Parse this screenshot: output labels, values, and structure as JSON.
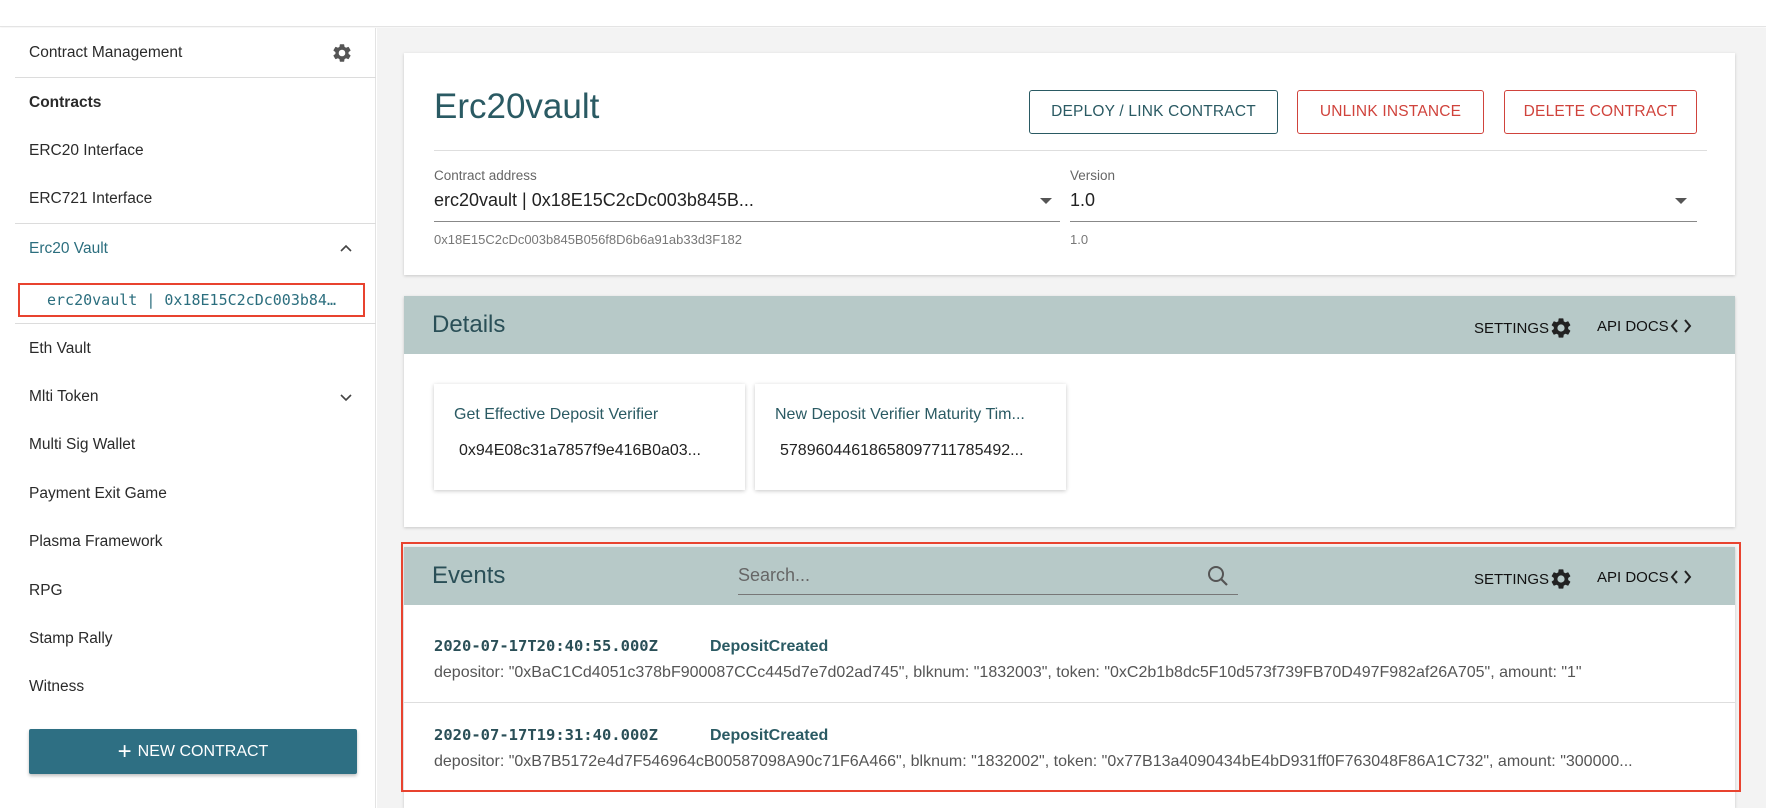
{
  "sidebar": {
    "header": "Contract Management",
    "items": [
      {
        "label": "Contracts"
      },
      {
        "label": "ERC20 Interface"
      },
      {
        "label": "ERC721 Interface"
      },
      {
        "label": "Erc20 Vault"
      },
      {
        "label": "Eth Vault"
      },
      {
        "label": "Mlti Token"
      },
      {
        "label": "Multi Sig Wallet"
      },
      {
        "label": "Payment Exit Game"
      },
      {
        "label": "Plasma Framework"
      },
      {
        "label": "RPG"
      },
      {
        "label": "Stamp Rally"
      },
      {
        "label": "Witness"
      }
    ],
    "selected_instance": "erc20vault | 0x18E15C2cDc003b84…",
    "new_contract_label": "NEW CONTRACT"
  },
  "contract": {
    "title": "Erc20vault",
    "buttons": {
      "deploy": "DEPLOY / LINK CONTRACT",
      "unlink": "UNLINK INSTANCE",
      "delete": "DELETE CONTRACT"
    },
    "address_label": "Contract address",
    "address_value": "erc20vault | 0x18E15C2cDc003b845B...",
    "address_help": "0x18E15C2cDc003b845B056f8D6b6a91ab33d3F182",
    "version_label": "Version",
    "version_value": "1.0",
    "version_help": "1.0"
  },
  "details": {
    "title": "Details",
    "settings": "SETTINGS",
    "api_docs": "API DOCS",
    "tiles": [
      {
        "title": "Get Effective Deposit Verifier",
        "value": "0x94E08c31a7857f9e416B0a03..."
      },
      {
        "title": "New Deposit Verifier Maturity Tim...",
        "value": "57896044618658097711785492..."
      }
    ]
  },
  "events": {
    "title": "Events",
    "search_placeholder": "Search...",
    "settings": "SETTINGS",
    "api_docs": "API DOCS",
    "items": [
      {
        "timestamp": "2020-07-17T20:40:55.000Z",
        "name": "DepositCreated",
        "data": "depositor: \"0xBaC1Cd4051c378bF900087CCc445d7e7d02ad745\", blknum: \"1832003\", token: \"0xC2b1b8dc5F10d573f739FB70D497F982af26A705\", amount: \"1\""
      },
      {
        "timestamp": "2020-07-17T19:31:40.000Z",
        "name": "DepositCreated",
        "data": "depositor: \"0xB7B5172e4d7F546964cB00587098A90c71F6A466\", blknum: \"1832002\", token: \"0x77B13a4090434bE4bD931ff0F763048F86A1C732\", amount: \"300000..."
      }
    ]
  },
  "colors": {
    "accent": "#2e6f83",
    "danger": "#d0433c",
    "section_header": "#b7c9c8",
    "highlight": "#e8432f"
  }
}
